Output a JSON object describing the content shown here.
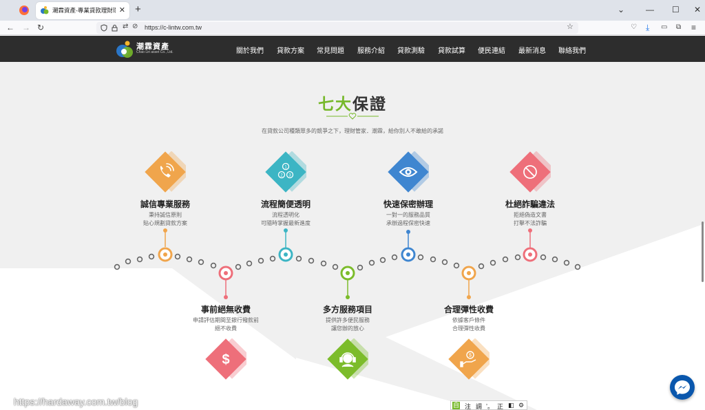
{
  "browser": {
    "tab_title": "潮霖資產-專業貸款理財環債顧問",
    "url": "https://c-lintw.com.tw"
  },
  "site": {
    "logo_name": "潮霖資產",
    "logo_sub": "Chao Lin asset Co., Ltd.",
    "menu": [
      "關於我們",
      "貸款方案",
      "常見問題",
      "服務介紹",
      "貸款測驗",
      "貸款試算",
      "便民連結",
      "最新消息",
      "聯絡我們"
    ]
  },
  "section": {
    "title_accent": "七大",
    "title_rest": "保證",
    "subtitle": "在貸款公司種類眾多的競爭之下，理財管家．潮霖，給你別人不敢給的承諾"
  },
  "features": [
    {
      "title": "誠信專業服務",
      "desc1": "秉持誠信原則",
      "desc2": "貼心規劃貸款方案",
      "color": "#f0a54c",
      "icon": "phone-icon"
    },
    {
      "title": "流程簡便透明",
      "desc1": "流程透明化",
      "desc2": "可隨時掌握最新進度",
      "color": "#3cb5c4",
      "icon": "steps-icon"
    },
    {
      "title": "快速保密辦理",
      "desc1": "一對一的服務品質",
      "desc2": "承辦過程保密快速",
      "color": "#3f86d0",
      "icon": "eye-icon"
    },
    {
      "title": "杜絕詐騙違法",
      "desc1": "拒絕偽造文書",
      "desc2": "打擊不法詐騙",
      "color": "#ee6f7a",
      "icon": "no-fraud-icon"
    },
    {
      "title": "事前絕無收費",
      "desc1": "申請評估期間至銀行撥款前",
      "desc2": "絕不收費",
      "color": "#ee6f7a",
      "icon": "dollar-icon"
    },
    {
      "title": "多方服務項目",
      "desc1": "提供許多便民服務",
      "desc2": "讓您辦的放心",
      "color": "#7cbc2b",
      "icon": "support-icon"
    },
    {
      "title": "合理彈性收費",
      "desc1": "依據客戶條件",
      "desc2": "合理彈性收費",
      "color": "#f0a54c",
      "icon": "money-hand-icon"
    }
  ],
  "overlay": {
    "watermark": "https://hardaway.com.tw/blog",
    "ime": [
      "注",
      "調",
      "ʼ。",
      "正"
    ]
  }
}
